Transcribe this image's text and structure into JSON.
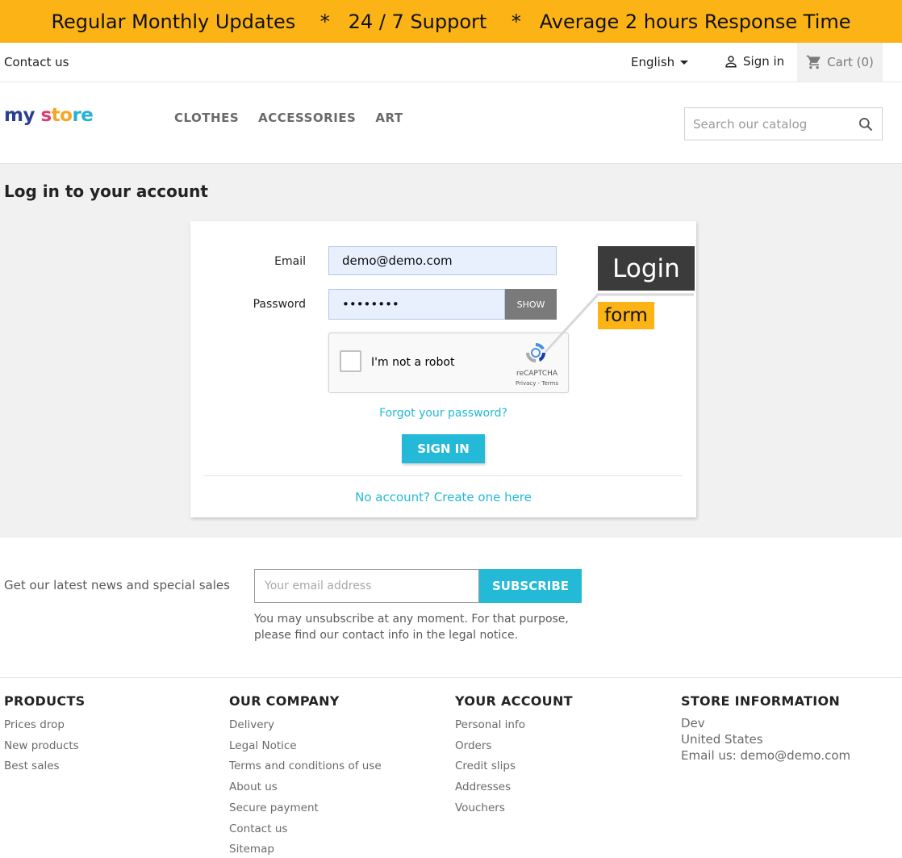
{
  "promo": {
    "text": "Regular Monthly Updates    *   24 / 7 Support    *   Average 2 hours Response Time"
  },
  "topnav": {
    "contact": "Contact us",
    "language": "English",
    "signin": "Sign in",
    "cart": "Cart (0)"
  },
  "header": {
    "logo": {
      "part1": "my",
      "part2": " s",
      "part3": "to",
      "part4": "re"
    },
    "nav": [
      "CLOTHES",
      "ACCESSORIES",
      "ART"
    ],
    "search_placeholder": "Search our catalog"
  },
  "page": {
    "title": "Log in to your account"
  },
  "login": {
    "email_label": "Email",
    "email_value": "demo@demo.com",
    "password_label": "Password",
    "password_value": "••••••••",
    "show_label": "SHOW",
    "captcha_text": "I'm not a robot",
    "captcha_brand": "reCAPTCHA",
    "captcha_terms": "Privacy - Terms",
    "forgot": "Forgot your password?",
    "signin_button": "SIGN IN",
    "no_account": "No account? Create one here"
  },
  "callout": {
    "title": "Login",
    "subtitle": "form"
  },
  "newsletter": {
    "text": "Get our latest news and special sales",
    "placeholder": "Your email address",
    "button": "SUBSCRIBE",
    "note": "You may unsubscribe at any moment. For that purpose, please find our contact info in the legal notice."
  },
  "footer": {
    "products": {
      "title": "PRODUCTS",
      "links": [
        "Prices drop",
        "New products",
        "Best sales"
      ]
    },
    "company": {
      "title": "OUR COMPANY",
      "links": [
        "Delivery",
        "Legal Notice",
        "Terms and conditions of use",
        "About us",
        "Secure payment",
        "Contact us",
        "Sitemap"
      ]
    },
    "account": {
      "title": "YOUR ACCOUNT",
      "links": [
        "Personal info",
        "Orders",
        "Credit slips",
        "Addresses",
        "Vouchers"
      ]
    },
    "store": {
      "title": "STORE INFORMATION",
      "lines": [
        "Dev",
        "United States",
        "Email us: demo@demo.com"
      ]
    }
  },
  "colors": {
    "accent": "#24b9d7",
    "promo": "#fbb316",
    "callout_dark": "#3b3b3b"
  }
}
